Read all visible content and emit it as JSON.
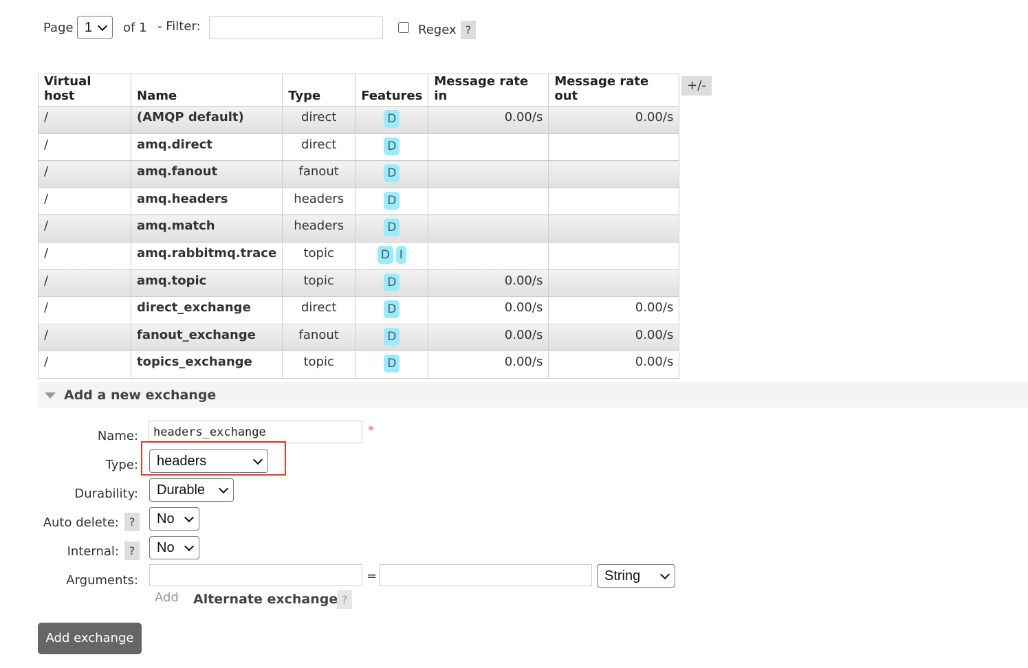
{
  "pagination": {
    "page_label": "Page",
    "page_value": "1",
    "of_label": "of 1",
    "filter_label": "- Filter:",
    "filter_value": "",
    "regex_label": "Regex",
    "help": "?"
  },
  "table": {
    "columns": [
      "Virtual host",
      "Name",
      "Type",
      "Features",
      "Message rate in",
      "Message rate out"
    ],
    "toggle_columns": "+/-",
    "rows": [
      {
        "vhost": "/",
        "name": "(AMQP default)",
        "type": "direct",
        "features": [
          "D"
        ],
        "rate_in": "0.00/s",
        "rate_out": "0.00/s"
      },
      {
        "vhost": "/",
        "name": "amq.direct",
        "type": "direct",
        "features": [
          "D"
        ],
        "rate_in": "",
        "rate_out": ""
      },
      {
        "vhost": "/",
        "name": "amq.fanout",
        "type": "fanout",
        "features": [
          "D"
        ],
        "rate_in": "",
        "rate_out": ""
      },
      {
        "vhost": "/",
        "name": "amq.headers",
        "type": "headers",
        "features": [
          "D"
        ],
        "rate_in": "",
        "rate_out": ""
      },
      {
        "vhost": "/",
        "name": "amq.match",
        "type": "headers",
        "features": [
          "D"
        ],
        "rate_in": "",
        "rate_out": ""
      },
      {
        "vhost": "/",
        "name": "amq.rabbitmq.trace",
        "type": "topic",
        "features": [
          "D",
          "I"
        ],
        "rate_in": "",
        "rate_out": ""
      },
      {
        "vhost": "/",
        "name": "amq.topic",
        "type": "topic",
        "features": [
          "D"
        ],
        "rate_in": "0.00/s",
        "rate_out": ""
      },
      {
        "vhost": "/",
        "name": "direct_exchange",
        "type": "direct",
        "features": [
          "D"
        ],
        "rate_in": "0.00/s",
        "rate_out": "0.00/s"
      },
      {
        "vhost": "/",
        "name": "fanout_exchange",
        "type": "fanout",
        "features": [
          "D"
        ],
        "rate_in": "0.00/s",
        "rate_out": "0.00/s"
      },
      {
        "vhost": "/",
        "name": "topics_exchange",
        "type": "topic",
        "features": [
          "D"
        ],
        "rate_in": "0.00/s",
        "rate_out": "0.00/s"
      }
    ]
  },
  "add_exchange": {
    "section_title": "Add a new exchange",
    "name_label": "Name:",
    "name_value": "headers_exchange",
    "required_mark": "*",
    "type_label": "Type:",
    "type_value": "headers",
    "durability_label": "Durability:",
    "durability_value": "Durable",
    "auto_delete_label": "Auto delete:",
    "auto_delete_value": "No",
    "internal_label": "Internal:",
    "internal_value": "No",
    "arguments_label": "Arguments:",
    "arg_key": "",
    "equals": "=",
    "arg_value": "",
    "arg_type": "String",
    "add_link": "Add",
    "alternate_exchange_link": "Alternate exchange",
    "help": "?",
    "submit_label": "Add exchange"
  },
  "colors": {
    "highlight_box": "#e53b23",
    "badge": "#99ebff",
    "button": "#666666"
  }
}
